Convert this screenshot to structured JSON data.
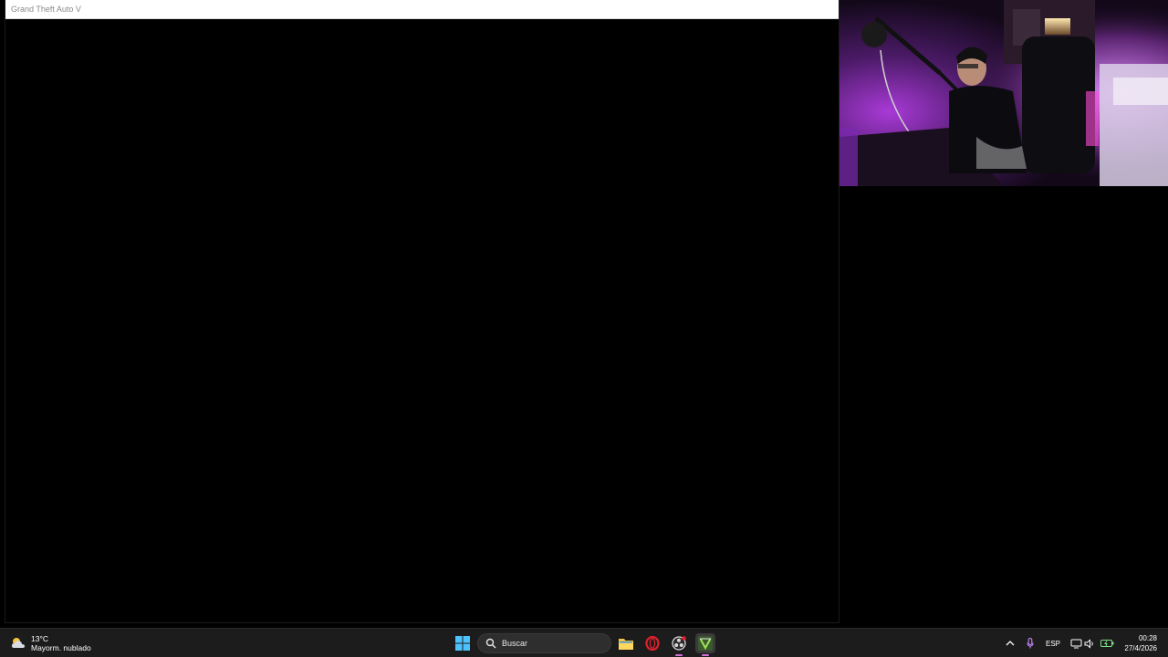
{
  "game_window": {
    "title": "Grand Theft Auto V"
  },
  "webcam": {
    "content": "streamer-camera-feed"
  },
  "taskbar": {
    "weather": {
      "temperature": "13°C",
      "condition": "Mayorm. nublado",
      "icon": "cloud-sun-icon"
    },
    "search": {
      "placeholder": "Buscar"
    },
    "apps": [
      {
        "name": "file-explorer-icon",
        "active": false
      },
      {
        "name": "opera-gx-icon",
        "active": false
      },
      {
        "name": "obs-studio-icon",
        "active": false
      },
      {
        "name": "gta-v-icon",
        "active": true
      }
    ],
    "tray": {
      "language": "ESP"
    },
    "clock": {
      "time": "00:28",
      "date": "27/4/2026"
    }
  },
  "colors": {
    "taskbar_bg": "#1c1c1c",
    "accent": "#d86fd8",
    "webcam_glow": "#b03ad8"
  }
}
